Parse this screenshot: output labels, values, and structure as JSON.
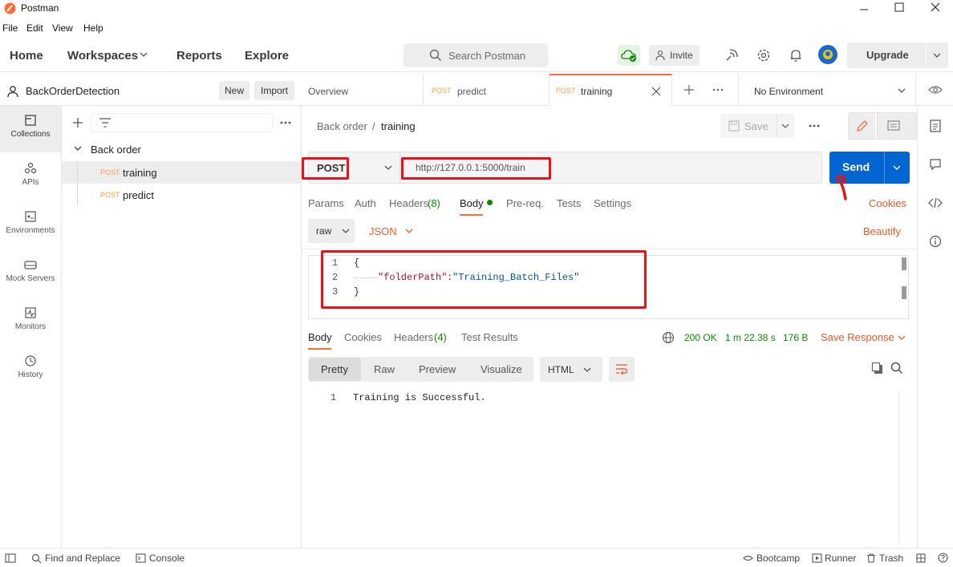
{
  "window": {
    "title": "Postman"
  },
  "menu": [
    "File",
    "Edit",
    "View",
    "Help"
  ],
  "header": {
    "home": "Home",
    "workspaces": "Workspaces",
    "reports": "Reports",
    "explore": "Explore",
    "search_placeholder": "Search Postman",
    "invite": "Invite",
    "upgrade": "Upgrade"
  },
  "workspace": {
    "name": "BackOrderDetection",
    "new": "New",
    "import": "Import"
  },
  "rail": [
    "Collections",
    "APIs",
    "Environments",
    "Mock Servers",
    "Monitors",
    "History"
  ],
  "tree": {
    "folder": "Back order",
    "items": [
      {
        "method": "POST",
        "name": "training"
      },
      {
        "method": "POST",
        "name": "predict"
      }
    ]
  },
  "tabs": {
    "overview": "Overview",
    "tab1": {
      "method": "POST",
      "name": "predict"
    },
    "tab2": {
      "method": "POST",
      "name": "training"
    },
    "environment": "No Environment"
  },
  "request": {
    "breadcrumb_parent": "Back order",
    "breadcrumb_sep": "/",
    "breadcrumb_current": "training",
    "save": "Save",
    "method": "POST",
    "url": "http://127.0.0.1:5000/train",
    "send": "Send",
    "tabs": {
      "params": "Params",
      "auth": "Auth",
      "headers": "Headers",
      "headers_count": "(8)",
      "body": "Body",
      "prereq": "Pre-req.",
      "tests": "Tests",
      "settings": "Settings"
    },
    "cookies": "Cookies",
    "body_mode": "raw",
    "body_lang": "JSON",
    "beautify": "Beautify",
    "code_lines": [
      {
        "num": "1",
        "text": "{"
      },
      {
        "num": "2",
        "key": "\"folderPath\"",
        "colon": ":",
        "value": "\"Training_Batch_Files\""
      },
      {
        "num": "3",
        "text": "}"
      }
    ]
  },
  "response": {
    "tabs": {
      "body": "Body",
      "cookies": "Cookies",
      "headers": "Headers",
      "headers_count": "(4)",
      "tests": "Test Results"
    },
    "status": "200 OK",
    "time": "1 m 22.38 s",
    "size": "176 B",
    "save_response": "Save Response",
    "views": [
      "Pretty",
      "Raw",
      "Preview",
      "Visualize"
    ],
    "format": "HTML",
    "lines": [
      {
        "num": "1",
        "text": "Training is Successful."
      }
    ]
  },
  "footer": {
    "find": "Find and Replace",
    "console": "Console",
    "bootcamp": "Bootcamp",
    "runner": "Runner",
    "trash": "Trash"
  },
  "colors": {
    "accent": "#ff6c37",
    "send_blue": "#0265d2",
    "post_orange": "#f6a04a",
    "status_green": "#0b8a00",
    "annotation_red": "#e3141c"
  }
}
